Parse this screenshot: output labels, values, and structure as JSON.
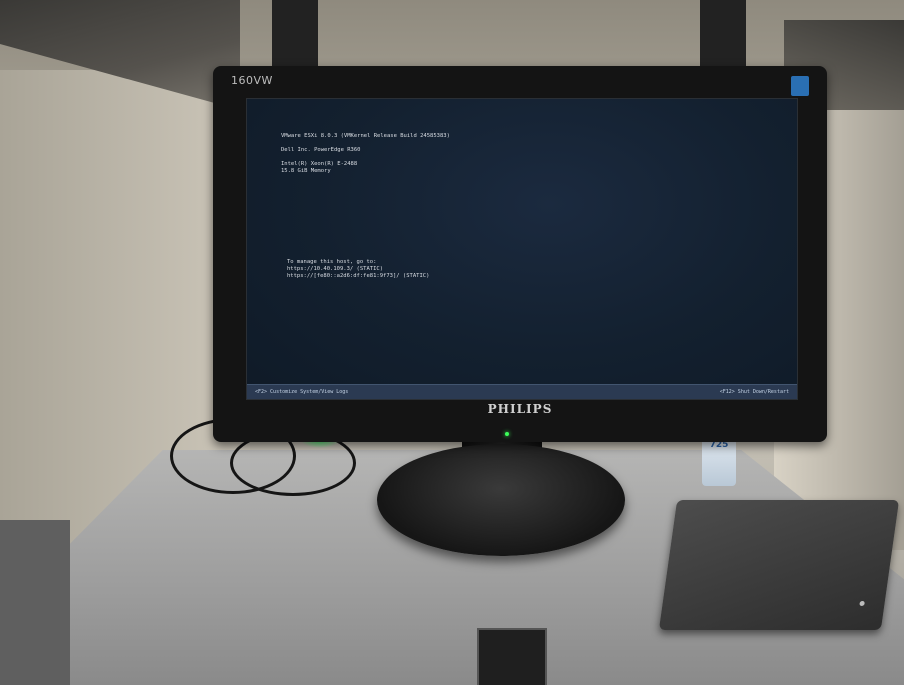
{
  "monitor": {
    "model": "160VW",
    "brand": "PHILIPS"
  },
  "console": {
    "top_lines": "VMware ESXi 8.0.3 (VMKernel Release Build 24585383)\n\nDell Inc. PowerEdge R360\n\nIntel(R) Xeon(R) E-2488\n15.8 GiB Memory",
    "manage_lines": "To manage this host, go to:\nhttps://10.40.109.3/ (STATIC)\nhttps://[fe80::a2d6:df:fe81:9f73]/ (STATIC)",
    "footer_left": "<F2> Customize System/View Logs",
    "footer_right": "<F12> Shut Down/Restart"
  },
  "bottle": {
    "label": "725"
  }
}
